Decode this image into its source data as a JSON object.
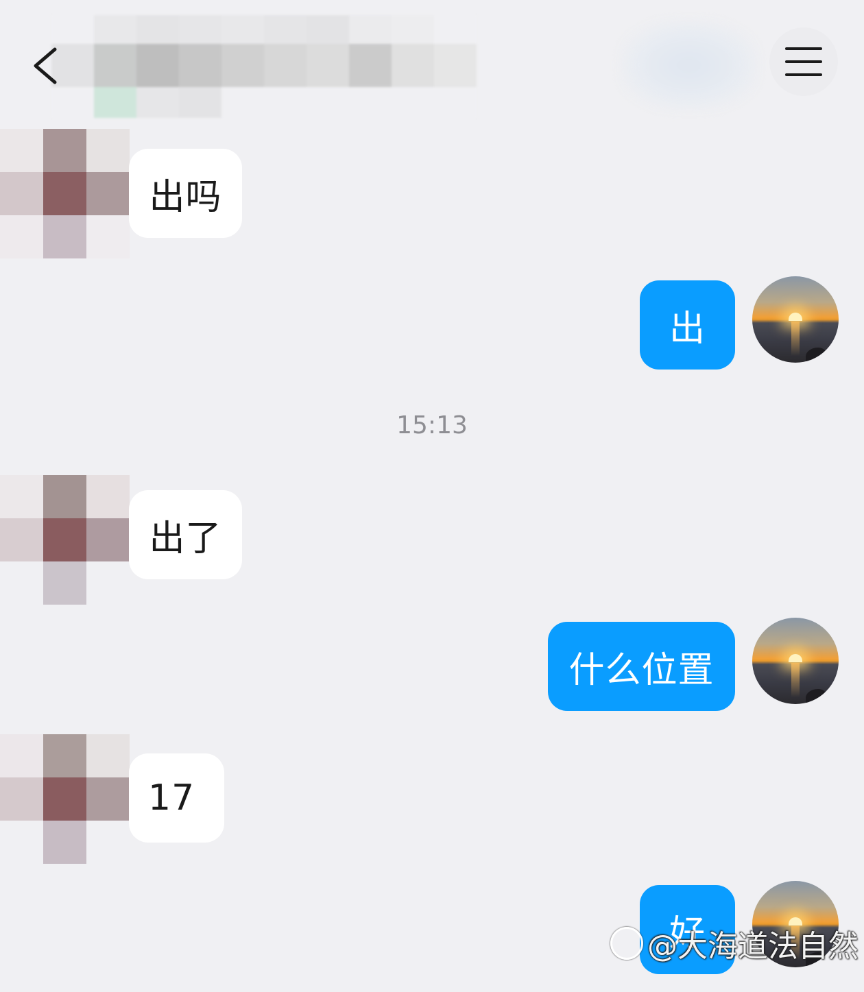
{
  "header": {
    "back_icon": "chevron-left-icon",
    "menu_icon": "hamburger-menu-icon"
  },
  "timestamp": "15:13",
  "messages": [
    {
      "direction": "in",
      "text": "出吗"
    },
    {
      "direction": "out",
      "text": "出"
    },
    {
      "direction": "in",
      "text": "出了"
    },
    {
      "direction": "out",
      "text": "什么位置"
    },
    {
      "direction": "in",
      "text": "17"
    },
    {
      "direction": "out",
      "text": "好"
    }
  ],
  "watermark": {
    "text": "@大海道法自然"
  },
  "colors": {
    "background": "#f0f0f3",
    "outgoing_bubble": "#0a9dff",
    "incoming_bubble": "#ffffff",
    "timestamp_text": "#8e8e93"
  }
}
